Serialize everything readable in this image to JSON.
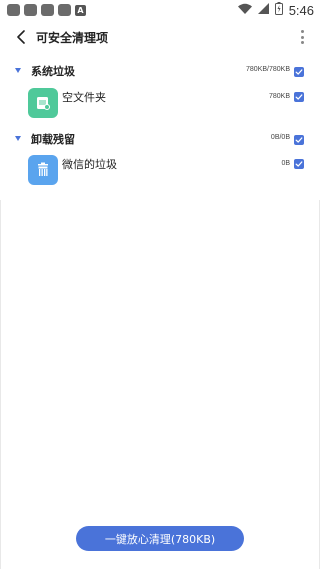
{
  "status_bar": {
    "time": "5:46",
    "icons": [
      "notification-icon",
      "notification-icon",
      "notification-icon",
      "sd-card-icon",
      "a-icon"
    ],
    "right_icons": [
      "wifi-icon",
      "signal-icon",
      "battery-icon"
    ]
  },
  "header": {
    "title": "可安全清理项"
  },
  "groups": [
    {
      "title": "系统垃圾",
      "size": "780KB/780KB",
      "checked": true,
      "items": [
        {
          "name": "空文件夹",
          "size": "780KB",
          "icon": "folder-icon",
          "icon_color": "#4fc99a",
          "checked": true
        }
      ]
    },
    {
      "title": "卸载残留",
      "size": "0B/0B",
      "checked": true,
      "items": [
        {
          "name": "微信的垃圾",
          "size": "0B",
          "icon": "trash-icon",
          "icon_color": "#5aa4ee",
          "checked": true
        }
      ]
    }
  ],
  "footer": {
    "clean_button_label": "一键放心清理(780KB)"
  },
  "colors": {
    "accent": "#4a73d9",
    "folder_green": "#4fc99a",
    "trash_blue": "#5aa4ee"
  }
}
